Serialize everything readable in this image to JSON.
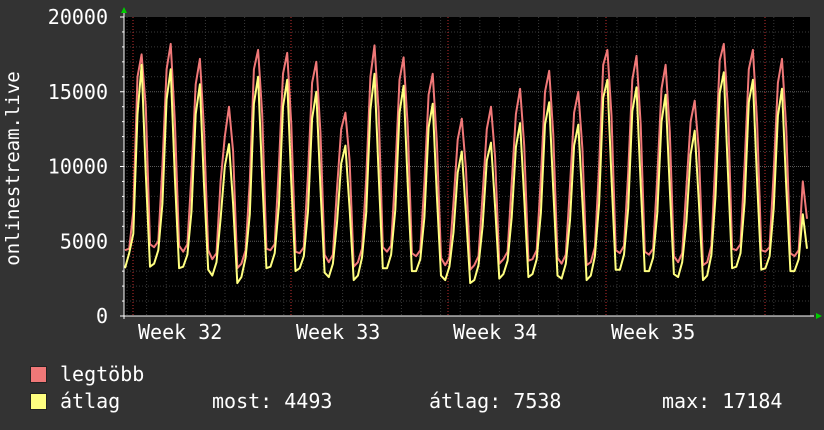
{
  "chart_data": {
    "type": "line",
    "title": "",
    "ylabel": "onlinestream.live",
    "xlabel": "",
    "ylim": [
      0,
      20000
    ],
    "yticks": [
      0,
      5000,
      10000,
      15000,
      20000
    ],
    "xtick_labels": [
      "Week 32",
      "Week 33",
      "Week 34",
      "Week 35"
    ],
    "grid": true,
    "series": [
      {
        "name": "legtöbb",
        "color": "#f07878",
        "pattern": [
          [
            4400,
            4500,
            7000,
            16000,
            17500,
            14000,
            4800
          ],
          [
            4600,
            5000,
            10000,
            16500,
            18200,
            13000,
            4700
          ],
          [
            4300,
            4800,
            9500,
            15500,
            17200,
            12500,
            4400
          ],
          [
            3800,
            4200,
            9000,
            12000,
            14000,
            11000,
            3200
          ],
          [
            3500,
            4400,
            9000,
            16500,
            17800,
            13500,
            4500
          ],
          [
            4400,
            4800,
            10000,
            16200,
            17600,
            12800,
            4300
          ],
          [
            4200,
            4600,
            9500,
            15600,
            17000,
            12200,
            4100
          ],
          [
            3600,
            4100,
            8600,
            12500,
            13600,
            10400,
            3300
          ],
          [
            3600,
            4500,
            9200,
            16000,
            18100,
            13600,
            4600
          ],
          [
            4300,
            4700,
            9600,
            15800,
            17300,
            12600,
            4200
          ],
          [
            4000,
            4400,
            8900,
            14800,
            16200,
            11600,
            3900
          ],
          [
            3400,
            3900,
            7600,
            11800,
            13200,
            9800,
            3100
          ],
          [
            3400,
            4000,
            8100,
            12500,
            14000,
            10600,
            3500
          ],
          [
            3800,
            4300,
            8900,
            13500,
            15200,
            11400,
            3700
          ],
          [
            3800,
            4400,
            9300,
            15000,
            16400,
            12100,
            3900
          ],
          [
            3500,
            4100,
            8700,
            13600,
            15000,
            11200,
            3400
          ],
          [
            3600,
            4600,
            10000,
            16800,
            17800,
            13400,
            4400
          ],
          [
            4200,
            4700,
            9600,
            15800,
            17400,
            12800,
            4300
          ],
          [
            4100,
            4500,
            9300,
            15200,
            16800,
            12300,
            4000
          ],
          [
            3600,
            4200,
            8600,
            13000,
            14400,
            11000,
            3400
          ],
          [
            3600,
            4700,
            10600,
            17100,
            18200,
            13800,
            4500
          ],
          [
            4400,
            4800,
            10100,
            16500,
            17800,
            13000,
            4400
          ],
          [
            4300,
            4600,
            9600,
            15600,
            17200,
            12600,
            4200
          ],
          [
            4000,
            4400,
            9000,
            6500
          ]
        ]
      },
      {
        "name": "átlag",
        "color": "#ffff80",
        "pattern": [
          [
            3200,
            4200,
            5500,
            13500,
            16800,
            9500,
            3300
          ],
          [
            3500,
            4400,
            7500,
            14500,
            16500,
            9200,
            3200
          ],
          [
            3300,
            4100,
            7000,
            13500,
            15500,
            8800,
            3100
          ],
          [
            2700,
            3600,
            6500,
            10000,
            11500,
            7500,
            2200
          ],
          [
            2600,
            3900,
            6800,
            14200,
            16000,
            9300,
            3200
          ],
          [
            3300,
            4200,
            7400,
            14000,
            15800,
            8900,
            3000
          ],
          [
            3200,
            4000,
            7000,
            13200,
            15000,
            8500,
            2900
          ],
          [
            2600,
            3500,
            6300,
            10200,
            11400,
            7200,
            2400
          ],
          [
            2700,
            3900,
            6900,
            13800,
            16200,
            9400,
            3200
          ],
          [
            3200,
            4100,
            7100,
            13600,
            15400,
            8700,
            3000
          ],
          [
            3000,
            3800,
            6600,
            12600,
            14200,
            8000,
            2700
          ],
          [
            2400,
            3300,
            5600,
            9600,
            11000,
            6800,
            2200
          ],
          [
            2400,
            3400,
            6000,
            10400,
            11600,
            7300,
            2500
          ],
          [
            2800,
            3700,
            6600,
            11300,
            12900,
            7900,
            2600
          ],
          [
            2800,
            3800,
            6900,
            12800,
            14300,
            8400,
            2700
          ],
          [
            2500,
            3500,
            6400,
            11400,
            12800,
            7700,
            2400
          ],
          [
            2700,
            4000,
            7500,
            14600,
            15800,
            9200,
            3100
          ],
          [
            3100,
            4100,
            7200,
            13700,
            15300,
            8800,
            3000
          ],
          [
            3000,
            3900,
            6900,
            13000,
            14800,
            8500,
            2800
          ],
          [
            2600,
            3600,
            6300,
            10800,
            12400,
            7600,
            2400
          ],
          [
            2700,
            4100,
            8000,
            14900,
            16300,
            9500,
            3200
          ],
          [
            3300,
            4200,
            7600,
            14300,
            15800,
            9000,
            3100
          ],
          [
            3200,
            4000,
            7200,
            13400,
            15200,
            8700,
            3000
          ],
          [
            3000,
            3800,
            6800,
            4500
          ]
        ]
      }
    ]
  },
  "legend": {
    "items": [
      {
        "label": "legtöbb",
        "color": "#f07878"
      },
      {
        "label": "átlag",
        "color": "#ffff80"
      }
    ]
  },
  "stats": {
    "current": "most: 4493",
    "average": "átlag: 7538",
    "max": "max: 17184"
  },
  "colors": {
    "background": "#333333",
    "plot_background": "#000000",
    "grid_major": "#5a5a5a",
    "grid_minor": "#3a3a3a",
    "week_marker": "#c03030",
    "axis_arrow": "#00cc00"
  }
}
